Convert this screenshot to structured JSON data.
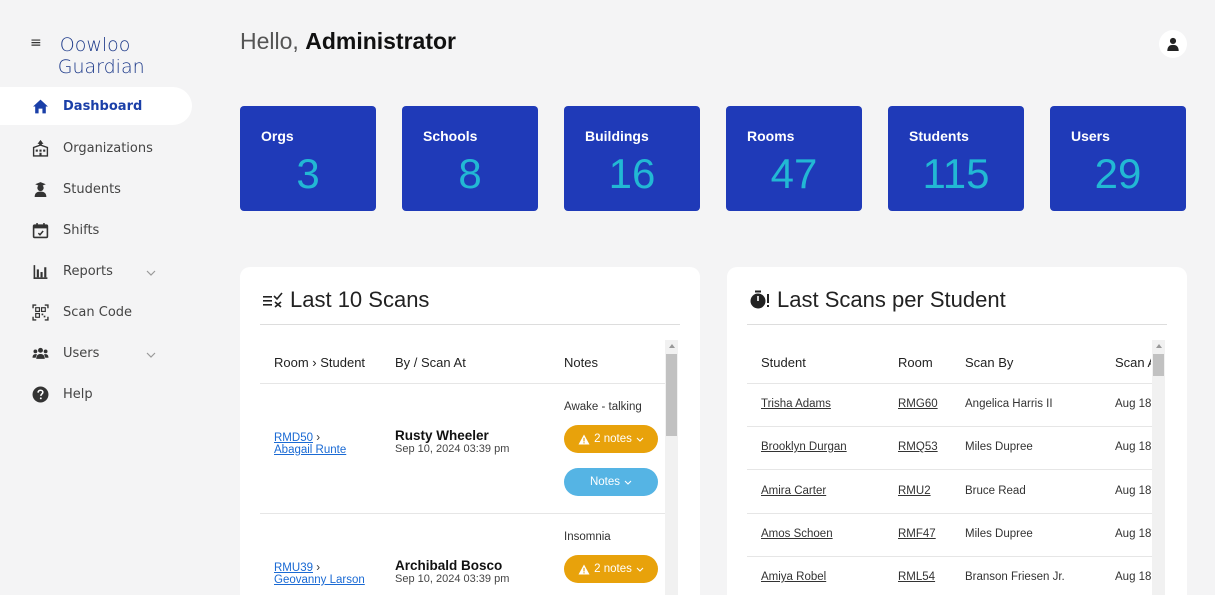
{
  "app": {
    "name_line1": "Oowloo",
    "name_line2": "Guardian"
  },
  "sidebar": {
    "items": [
      {
        "label": "Dashboard",
        "icon": "home-icon",
        "active": true
      },
      {
        "label": "Organizations",
        "icon": "building-icon"
      },
      {
        "label": "Students",
        "icon": "student-icon"
      },
      {
        "label": "Shifts",
        "icon": "calendar-icon"
      },
      {
        "label": "Reports",
        "icon": "bar-chart-icon",
        "expandable": true
      },
      {
        "label": "Scan Code",
        "icon": "qr-code-icon"
      },
      {
        "label": "Users",
        "icon": "users-icon",
        "expandable": true
      },
      {
        "label": "Help",
        "icon": "help-icon"
      }
    ]
  },
  "header": {
    "greeting": "Hello,",
    "user_name": "Administrator"
  },
  "stats": [
    {
      "label": "Orgs",
      "value": "3"
    },
    {
      "label": "Schools",
      "value": "8"
    },
    {
      "label": "Buildings",
      "value": "16"
    },
    {
      "label": "Rooms",
      "value": "47"
    },
    {
      "label": "Students",
      "value": "115"
    },
    {
      "label": "Users",
      "value": "29"
    }
  ],
  "last_scans": {
    "title": "Last 10 Scans",
    "columns": [
      "Room › Student",
      "By / Scan At",
      "Notes"
    ],
    "rows": [
      {
        "room": "RMD50",
        "student": "Abagail Runte",
        "by": "Rusty Wheeler",
        "scan_at": "Sep 10, 2024 03:39 pm",
        "note": "Awake - talking",
        "notes_count": "2 notes",
        "notes_button": "Notes"
      },
      {
        "room": "RMU39",
        "student": "Geovanny Larson",
        "by": "Archibald Bosco",
        "scan_at": "Sep 10, 2024 03:39 pm",
        "note": "Insomnia",
        "notes_count": "2 notes"
      }
    ]
  },
  "per_student": {
    "title": "Last Scans per Student",
    "columns": [
      "Student",
      "Room",
      "Scan By",
      "Scan A"
    ],
    "rows": [
      {
        "student": "Trisha Adams",
        "room": "RMG60",
        "scan_by": "Angelica Harris II",
        "scan_at": "Aug 18,"
      },
      {
        "student": "Brooklyn Durgan",
        "room": "RMQ53",
        "scan_by": "Miles Dupree",
        "scan_at": "Aug 18,"
      },
      {
        "student": "Amira Carter",
        "room": "RMU2",
        "scan_by": "Bruce Read",
        "scan_at": "Aug 18,"
      },
      {
        "student": "Amos Schoen",
        "room": "RMF47",
        "scan_by": "Miles Dupree",
        "scan_at": "Aug 18,"
      },
      {
        "student": "Amiya Robel",
        "room": "RML54",
        "scan_by": "Branson Friesen Jr.",
        "scan_at": "Aug 18,"
      }
    ]
  },
  "colors": {
    "accent": "#1f3ab8",
    "stat_value": "#22b8d4",
    "warn": "#e8a20b",
    "info": "#55b4e4",
    "link": "#1a6ad4"
  }
}
